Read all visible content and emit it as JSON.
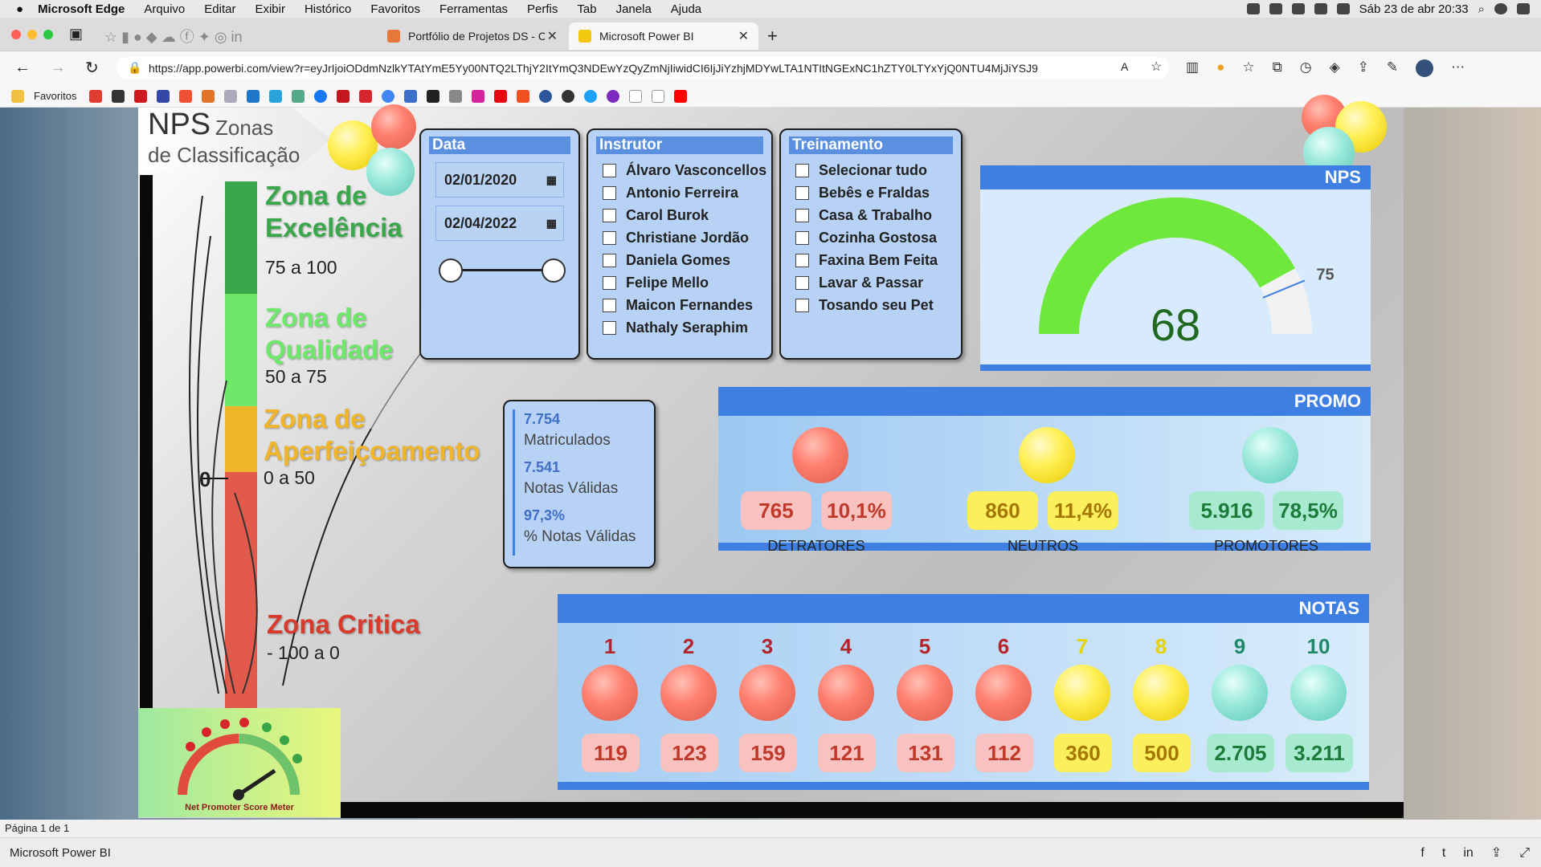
{
  "menubar": {
    "app_name": "Microsoft Edge",
    "items": [
      "Arquivo",
      "Editar",
      "Exibir",
      "Histórico",
      "Favoritos",
      "Ferramentas",
      "Perfis",
      "Tab",
      "Janela",
      "Ajuda"
    ],
    "datetime": "Sáb 23 de abr  20:33"
  },
  "tabs": [
    {
      "title": "Portfólio de Projetos DS - Com",
      "active": false
    },
    {
      "title": "Microsoft Power BI",
      "active": true
    }
  ],
  "address_bar": {
    "url": "https://app.powerbi.com/view?r=eyJrIjoiODdmNzlkYTAtYmE5Yy00NTQ2LThjY2ItYmQ3NDEwYzQyZmNjIiwidCI6IjJiYzhjMDYwLTA1NTItNGExNC1hZTY0LTYxYjQ0NTU4MjJiYSJ9"
  },
  "favorites": {
    "label": "Favoritos"
  },
  "report": {
    "nps_title": "NPS",
    "zones_title_1": "Zonas",
    "zones_title_2": "de Classificação",
    "zone_zero_label": "0",
    "zones": [
      {
        "name_1": "Zona de",
        "name_2": "Excelência",
        "range": "75 a 100",
        "color": "#3aa84a"
      },
      {
        "name_1": "Zona de",
        "name_2": "Qualidade",
        "range": "50 a 75",
        "color": "#6ee86a"
      },
      {
        "name_1": "Zona de",
        "name_2": "Aperfeiçoamento",
        "range": "0 a 50",
        "color": "#f0b52a"
      },
      {
        "name_1": "Zona Critica",
        "name_2": "",
        "range": "- 100 a 0",
        "color": "#e25a4c"
      }
    ],
    "logo_caption": "Net Promoter Score Meter",
    "data_filter": {
      "title": "Data",
      "start": "02/01/2020",
      "end": "02/04/2022"
    },
    "instrutor_filter": {
      "title": "Instrutor",
      "options": [
        "Álvaro Vasconcellos",
        "Antonio Ferreira",
        "Carol Burok",
        "Christiane Jordão",
        "Daniela Gomes",
        "Felipe Mello",
        "Maicon Fernandes",
        "Nathaly Seraphim"
      ]
    },
    "treinamento_filter": {
      "title": "Treinamento",
      "options": [
        "Selecionar tudo",
        "Bebês e Fraldas",
        "Casa & Trabalho",
        "Cozinha Gostosa",
        "Faxina Bem Feita",
        "Lavar & Passar",
        "Tosando seu Pet"
      ]
    },
    "nps_gauge": {
      "title": "NPS",
      "value": "68",
      "target": "75",
      "min": -100,
      "max": 100,
      "value_num": 68,
      "target_num": 75
    },
    "cards": [
      {
        "value": "7.754",
        "label": "Matriculados"
      },
      {
        "value": "7.541",
        "label": "Notas Válidas"
      },
      {
        "value": "97,3%",
        "label": "% Notas Válidas"
      }
    ],
    "promo": {
      "title": "PROMO",
      "groups": [
        {
          "count": "765",
          "pct": "10,1%",
          "label": "DETRATORES"
        },
        {
          "count": "860",
          "pct": "11,4%",
          "label": "NEUTROS"
        },
        {
          "count": "5.916",
          "pct": "78,5%",
          "label": "PROMOTORES"
        }
      ]
    },
    "notas": {
      "title": "NOTAS",
      "scores": [
        "1",
        "2",
        "3",
        "4",
        "5",
        "6",
        "7",
        "8",
        "9",
        "10"
      ],
      "counts": [
        "119",
        "123",
        "159",
        "121",
        "131",
        "112",
        "360",
        "500",
        "2.705",
        "3.211"
      ]
    }
  },
  "status": {
    "page": "Página 1 de 1",
    "footer_title": "Microsoft Power BI"
  }
}
